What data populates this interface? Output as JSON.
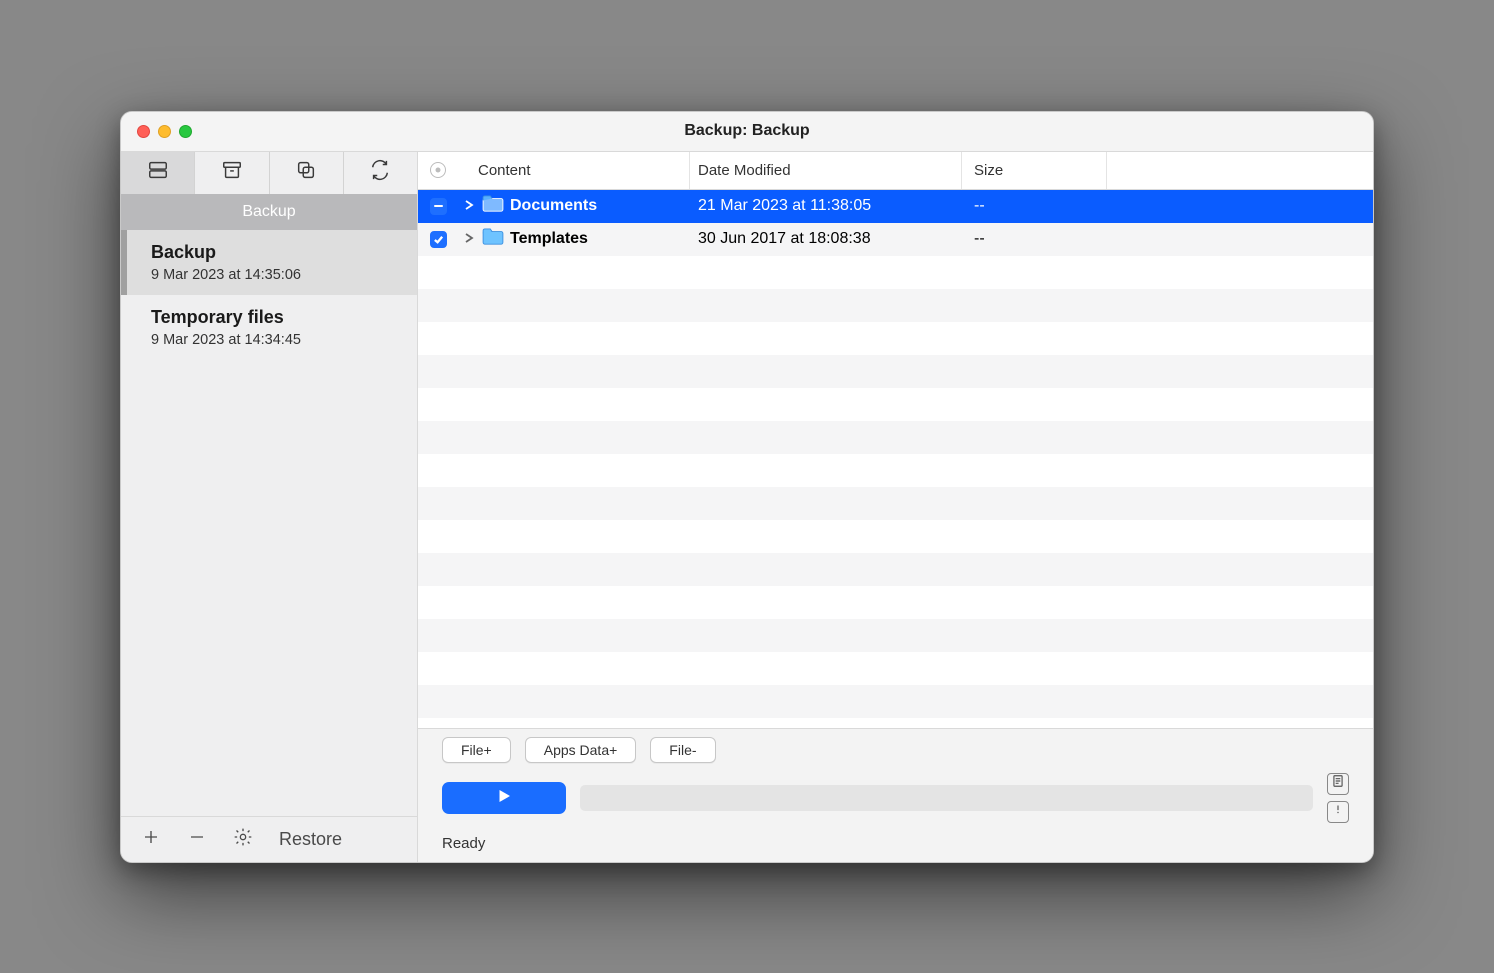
{
  "window": {
    "title": "Backup: Backup"
  },
  "sidebar": {
    "section_label": "Backup",
    "items": [
      {
        "title": "Backup",
        "subtitle": "9 Mar 2023 at 14:35:06",
        "selected": true
      },
      {
        "title": "Temporary files",
        "subtitle": "9 Mar 2023 at 14:34:45",
        "selected": false
      }
    ],
    "footer": {
      "restore_label": "Restore"
    }
  },
  "columns": {
    "content": "Content",
    "date": "Date Modified",
    "size": "Size"
  },
  "rows": [
    {
      "name": "Documents",
      "date": "21 Mar 2023 at 11:38:05",
      "size": "--",
      "selected": true,
      "check": "mixed"
    },
    {
      "name": "Templates",
      "date": "30 Jun 2017 at 18:08:38",
      "size": "--",
      "selected": false,
      "check": "checked"
    }
  ],
  "actions": {
    "file_plus": "File+",
    "apps_data_plus": "Apps Data+",
    "file_minus": "File-",
    "status": "Ready"
  }
}
